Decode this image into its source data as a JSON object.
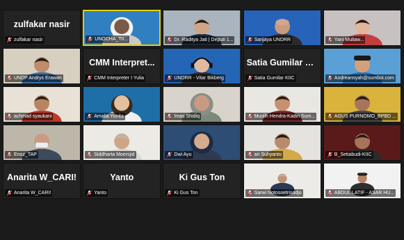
{
  "participants": [
    {
      "name": "zulfakar nasir",
      "display": "zulfakar nasir",
      "video": false
    },
    {
      "name": "UNOCHA_Tri...",
      "video": true,
      "bg": "#2f7fc1",
      "skin": "#7a5a48",
      "shirt": "#c9c9c9",
      "head": "hijab-white",
      "active": true
    },
    {
      "name": "Dr. Raditya Jati | Deputi 1...",
      "video": true,
      "bg": "#a9b4bf",
      "skin": "#d0a586",
      "shirt": "#1f2b3a",
      "head": "dark-hair"
    },
    {
      "name": "Sanjaya UNDRR",
      "video": true,
      "bg": "#2763b8",
      "skin": "#c89a7e",
      "shirt": "#2a2a2a",
      "head": "bald"
    },
    {
      "name": "Yani Muliaw...",
      "video": true,
      "bg": "#c7c1c1",
      "skin": "#e0b79c",
      "shirt": "#c33f3f",
      "head": "dark-hair"
    },
    {
      "name": "UNDP Andrys Erawan",
      "video": true,
      "bg": "#d7d0c0",
      "skin": "#c08b6a",
      "shirt": "#3a6fa8",
      "head": "dark-hair"
    },
    {
      "name": "CMM Interpreter I Yulia",
      "display": "CMM Interpret...",
      "video": false
    },
    {
      "name": "UNDRR - Vitar Bikberg",
      "video": true,
      "bg": "#2565b5",
      "skin": "#e1b9a0",
      "shirt": "#2a2a2a",
      "head": "headset"
    },
    {
      "name": "Satia Gumilar KIIC",
      "display": "Satia Gumilar K...",
      "video": false
    },
    {
      "name": "Andreansyah@sumboi.com",
      "video": true,
      "bg": "#5aa0d6",
      "skin": "#d3a07a",
      "shirt": "#2b6fb0",
      "head": "cap"
    },
    {
      "name": "achmad syaukani",
      "video": true,
      "bg": "#e7e1d6",
      "skin": "#b98462",
      "shirt": "#c0392b",
      "head": "dark-hair"
    },
    {
      "name": "Amalia Yunita",
      "video": true,
      "bg": "#1e6fa7",
      "skin": "#e2c0a0",
      "shirt": "#f0f0f0",
      "head": "long-hair"
    },
    {
      "name": "Imas Shidiq",
      "video": true,
      "bg": "#d8d4cc",
      "skin": "#c89b80",
      "shirt": "#7b8a7a",
      "head": "hijab-grey"
    },
    {
      "name": "Muslih Hendra-Kadin Sum...",
      "video": true,
      "bg": "#e9e7e2",
      "skin": "#c6916f",
      "shirt": "#7c2b2b",
      "head": "dark-hair"
    },
    {
      "name": "AGUS PURNOMO_BPBD ...",
      "video": true,
      "bg": "#d9b33b",
      "skin": "#a8745a",
      "shirt": "#4a4a4a",
      "head": "dark-hair"
    },
    {
      "name": "Enoz_TAP",
      "video": true,
      "bg": "#bdb7aa",
      "skin": "#c99b82",
      "shirt": "#3b4b5c",
      "head": "mask"
    },
    {
      "name": "Siddharta Moersjid",
      "video": true,
      "bg": "#ebeae4",
      "skin": "#cfa588",
      "shirt": "#d8d8d8",
      "head": "grey-hair"
    },
    {
      "name": "Dwi Ayu",
      "video": true,
      "bg": "#2d4d74",
      "skin": "#d4ab8e",
      "shirt": "#2f3a52",
      "head": "hijab-navy"
    },
    {
      "name": "ari Suhyanto",
      "video": true,
      "bg": "#e5e3df",
      "skin": "#b98a6c",
      "shirt": "#d4a94a",
      "head": "dark-hair"
    },
    {
      "name": "B_Setiabudi-KIIC",
      "video": true,
      "bg": "#5b1a1a",
      "skin": "#a87358",
      "shirt": "#2b2b2b",
      "head": "dark-hair"
    },
    {
      "name": "Anarita W_CARI!",
      "display": "Anarita W_CARI!",
      "video": false
    },
    {
      "name": "Yanto",
      "display": "Yanto",
      "video": false
    },
    {
      "name": "Ki Gus Ton",
      "display": "Ki Gus Ton",
      "video": false
    },
    {
      "name": "Sarwi Notosoetrisodjo",
      "video": true,
      "bg": "#ecebe8",
      "skin": "#c39273",
      "shirt": "#2a3a55",
      "head": "grey-hair",
      "small": true
    },
    {
      "name": "ABDUL LATIF - ASAR HU...",
      "video": true,
      "bg": "#f2f2f2",
      "skin": "#b58566",
      "shirt": "#2f2f2f",
      "head": "cap-dark",
      "small": true
    }
  ]
}
